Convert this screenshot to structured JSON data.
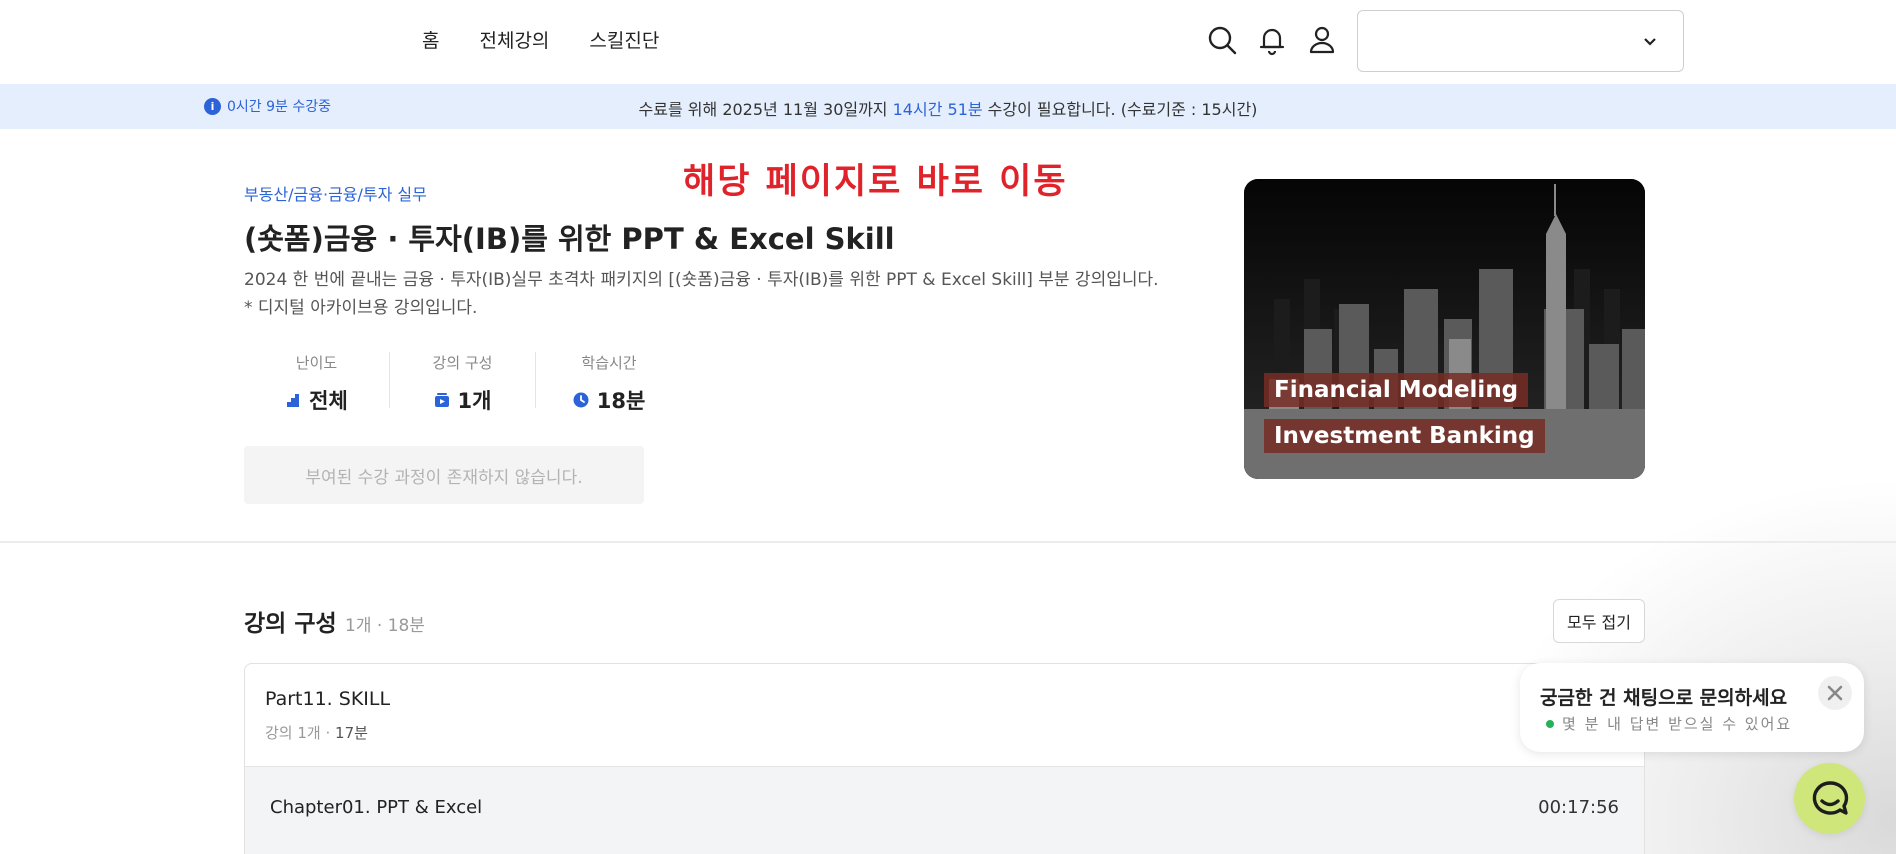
{
  "nav": {
    "home": "홈",
    "all_courses": "전체강의",
    "skill_diagnosis": "스킬진단"
  },
  "header": {
    "org_select_value": ""
  },
  "notice": {
    "watch_time": "0시간 9분 수강중",
    "prefix": "수료를 위해 2025년 11월 30일까지 ",
    "required": "14시간 51분",
    "suffix": " 수강이 필요합니다. (수료기준 : 15시간)"
  },
  "overlay_text": "해당 페이지로 바로 이동",
  "course": {
    "category": "부동산/금융·금융/투자 실무",
    "title": "(숏폼)금융 · 투자(IB)를 위한 PPT & Excel Skill",
    "desc1": "2024 한 번에 끝내는 금융 · 투자(IB)실무 초격차 패키지의 [(숏폼)금융 · 투자(IB)를 위한 PPT & Excel Skill] 부분 강의입니다.",
    "desc2": "* 디지털 아카이브용 강의입니다.",
    "stats": [
      {
        "label": "난이도",
        "value": "전체"
      },
      {
        "label": "강의 구성",
        "value": "1개"
      },
      {
        "label": "학습시간",
        "value": "18분"
      }
    ],
    "enroll_notice": "부여된 수강 과정이 존재하지 않습니다.",
    "thumbnail_tags": [
      "Financial Modeling",
      "Investment Banking"
    ]
  },
  "curriculum": {
    "title": "강의 구성",
    "meta": "1개 · 18분",
    "collapse_label": "모두 접기",
    "part": {
      "title": "Part11. SKILL",
      "meta_label": "강의 1개 · ",
      "meta_time": "17분",
      "chapter": {
        "title": "Chapter01. PPT & Excel",
        "duration": "00:17:56"
      }
    }
  },
  "chat": {
    "title": "궁금한 건 채팅으로 문의하세요",
    "subtitle": "몇 분 내 답변 받으실 수 있어요"
  },
  "colors": {
    "accent": "#2d63d9",
    "notice_bg": "#e5eefc",
    "overlay_red": "#e0232b",
    "chat_button": "#cfe67a"
  }
}
